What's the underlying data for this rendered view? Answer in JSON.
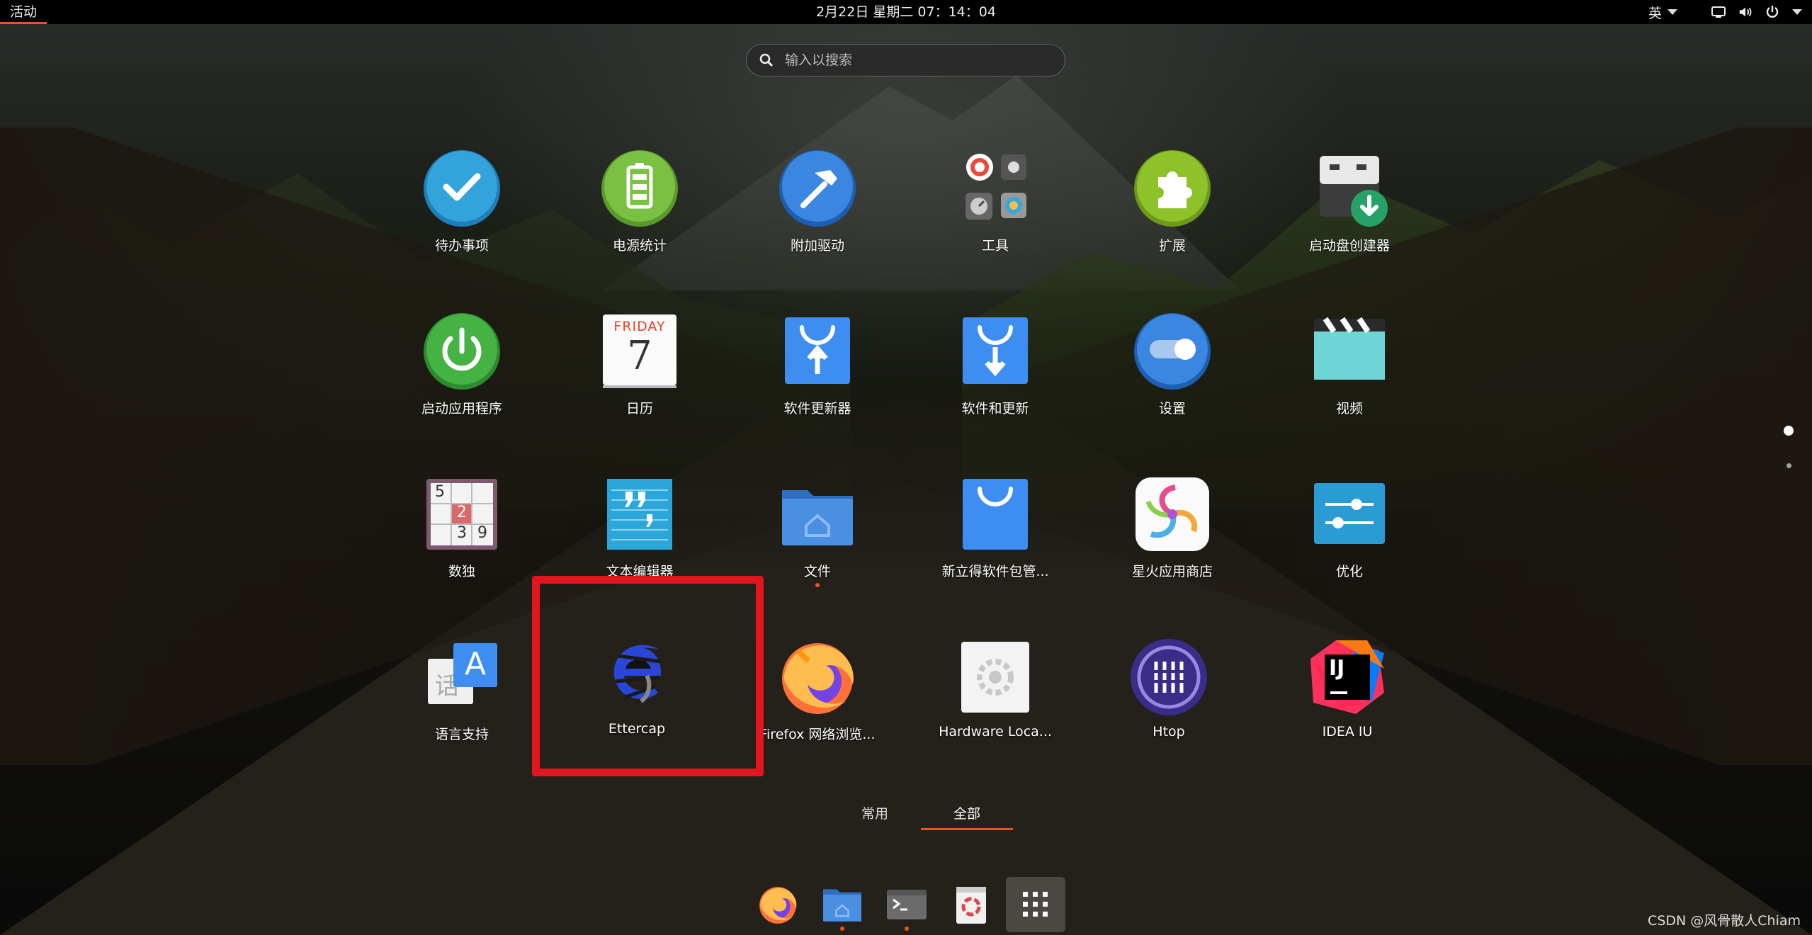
{
  "topbar": {
    "activities": "活动",
    "clock": "2月22日 星期二  07：14：04",
    "input_method": "英"
  },
  "search": {
    "placeholder": "输入以搜索"
  },
  "apps": [
    {
      "label": "待办事项",
      "icon": "todo-icon"
    },
    {
      "label": "电源统计",
      "icon": "power-statistics-icon"
    },
    {
      "label": "附加驱动",
      "icon": "additional-drivers-icon"
    },
    {
      "label": "工具",
      "icon": "utilities-folder-icon"
    },
    {
      "label": "扩展",
      "icon": "extensions-icon"
    },
    {
      "label": "启动盘创建器",
      "icon": "startup-disk-creator-icon"
    },
    {
      "label": "启动应用程序",
      "icon": "startup-applications-icon"
    },
    {
      "label": "日历",
      "icon": "calendar-icon",
      "calendar_day": "FRIDAY",
      "calendar_date": "7"
    },
    {
      "label": "软件更新器",
      "icon": "software-updater-icon"
    },
    {
      "label": "软件和更新",
      "icon": "software-and-updates-icon"
    },
    {
      "label": "设置",
      "icon": "settings-icon"
    },
    {
      "label": "视频",
      "icon": "videos-icon"
    },
    {
      "label": "数独",
      "icon": "sudoku-icon",
      "digits": [
        "5",
        "2",
        "3",
        "9"
      ]
    },
    {
      "label": "文本编辑器",
      "icon": "text-editor-icon"
    },
    {
      "label": "文件",
      "icon": "files-icon"
    },
    {
      "label": "新立得软件包管...",
      "icon": "synaptic-icon"
    },
    {
      "label": "星火应用商店",
      "icon": "spark-store-icon"
    },
    {
      "label": "优化",
      "icon": "tweaks-icon"
    },
    {
      "label": "语言支持",
      "icon": "language-support-icon",
      "glyph": "A"
    },
    {
      "label": "Ettercap",
      "icon": "ettercap-icon"
    },
    {
      "label": "Firefox 网络浏览...",
      "icon": "firefox-icon"
    },
    {
      "label": "Hardware Loca...",
      "icon": "hardware-locality-icon"
    },
    {
      "label": "Htop",
      "icon": "htop-icon"
    },
    {
      "label": "IDEA IU",
      "icon": "intellij-idea-icon",
      "glyph": "IJ"
    }
  ],
  "tabs": [
    {
      "label": "常用",
      "active": false
    },
    {
      "label": "全部",
      "active": true
    }
  ],
  "dock": [
    {
      "name": "firefox",
      "icon": "firefox-icon",
      "running": false
    },
    {
      "name": "files",
      "icon": "files-icon",
      "running": true
    },
    {
      "name": "terminal",
      "icon": "terminal-icon",
      "running": true
    },
    {
      "name": "trash",
      "icon": "trash-icon",
      "running": false
    },
    {
      "name": "show-applications",
      "icon": "app-grid-icon",
      "running": false
    }
  ],
  "watermark": "CSDN @风骨散人Chiam",
  "colors": {
    "accent": "#e95420",
    "highlight": "#e1161f"
  }
}
